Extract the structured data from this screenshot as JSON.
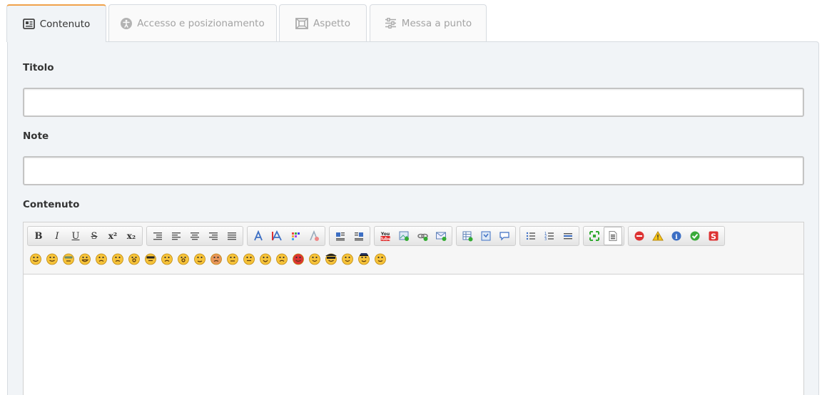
{
  "tabs": [
    {
      "label": "Contenuto",
      "icon": "newspaper-icon",
      "active": true
    },
    {
      "label": "Accesso e posizionamento",
      "icon": "accessibility-icon",
      "active": false
    },
    {
      "label": "Aspetto",
      "icon": "frame-icon",
      "active": false
    },
    {
      "label": "Messa a punto",
      "icon": "sliders-icon",
      "active": false
    }
  ],
  "form": {
    "title_label": "Titolo",
    "title_value": "",
    "note_label": "Note",
    "note_value": "",
    "content_label": "Contenuto"
  },
  "toolbar": {
    "groups": [
      [
        "bold",
        "italic",
        "underline",
        "strikethrough",
        "superscript",
        "subscript"
      ],
      [
        "indent",
        "align-left",
        "align-center",
        "align-right",
        "justify"
      ],
      [
        "font-face",
        "font-size",
        "color",
        "remove-format"
      ],
      [
        "float-left",
        "float-right"
      ],
      [
        "youtube",
        "insert-image",
        "insert-link",
        "insert-email"
      ],
      [
        "insert-table",
        "insert-code",
        "insert-quote"
      ],
      [
        "bullet-list",
        "numbered-list",
        "horizontal-rule"
      ],
      [
        "maximize",
        "source"
      ],
      [
        "stop",
        "warning",
        "info",
        "ok",
        "spoiler"
      ]
    ],
    "text_glyphs": {
      "bold": "B",
      "italic": "I",
      "underline": "U",
      "strikethrough": "S",
      "superscript": "x²",
      "subscript": "x₂"
    },
    "smileys_count": 22
  },
  "colors": {
    "active_tab_accent": "#f0a24b",
    "panel_bg": "#f1f4f7",
    "smiley_face": "#f6c33a"
  }
}
